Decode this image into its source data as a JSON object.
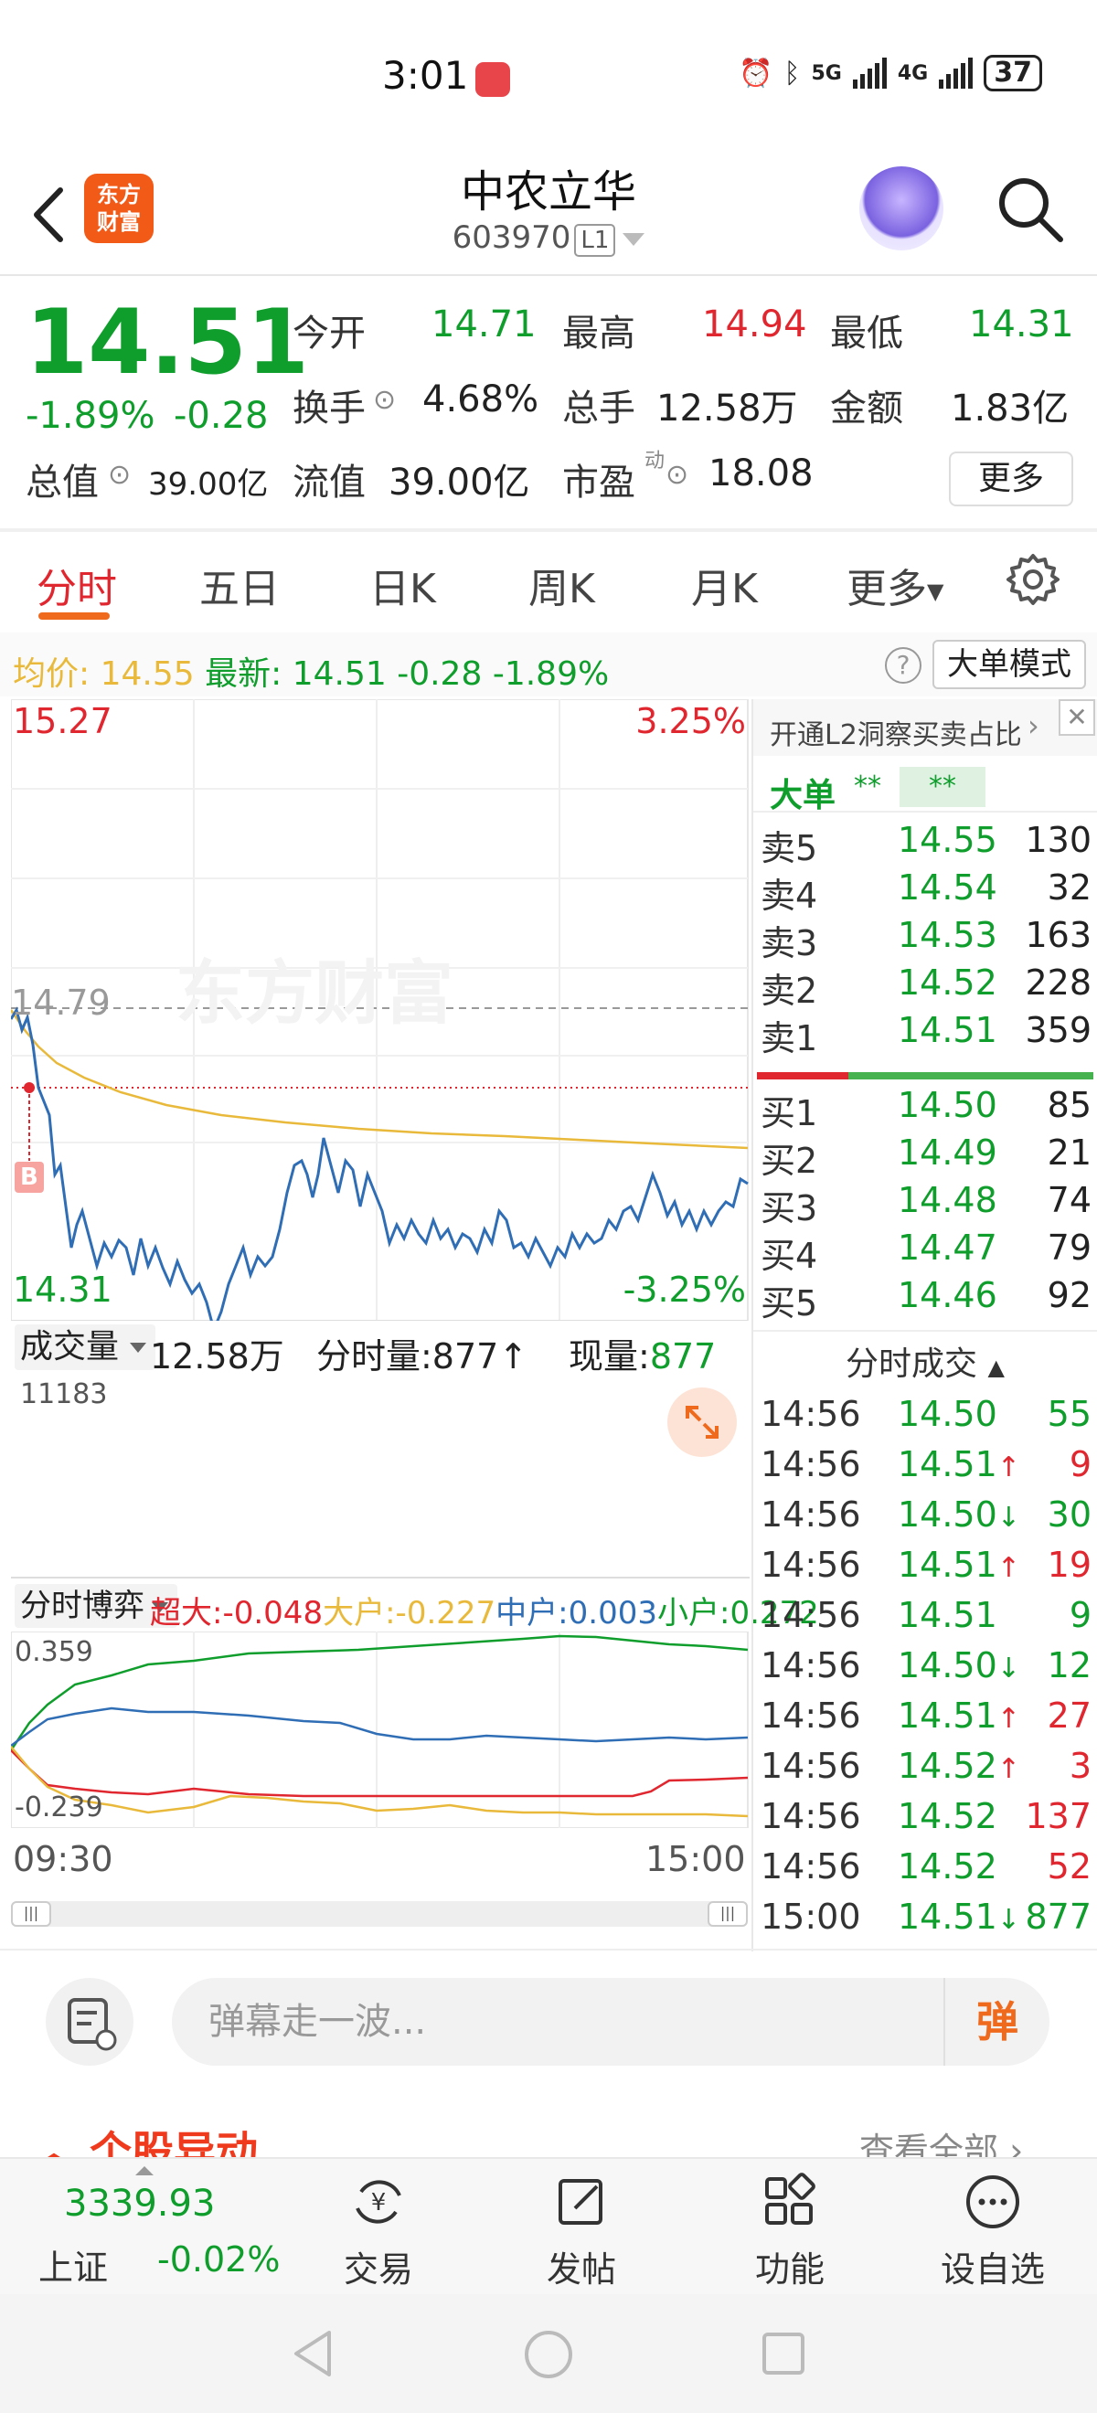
{
  "status_bar": {
    "time": "3:01",
    "network_5g": "5G",
    "network_4g": "4G",
    "battery": "37"
  },
  "header": {
    "title": "中农立华",
    "code": "603970",
    "level": "L1",
    "logo_text_1": "东方",
    "logo_text_2": "财富"
  },
  "quote": {
    "price": "14.51",
    "change_pct": "-1.89%",
    "change_val": "-0.28",
    "open_label": "今开",
    "open": "14.71",
    "high_label": "最高",
    "high": "14.94",
    "low_label": "最低",
    "low": "14.31",
    "turnover_label": "换手",
    "turnover": "4.68%",
    "volume_label": "总手",
    "volume": "12.58万",
    "amount_label": "金额",
    "amount": "1.83亿",
    "total_value_label": "总值",
    "total_value": "39.00亿",
    "float_value_label": "流值",
    "float_value": "39.00亿",
    "pe_label": "市盈",
    "pe_sup": "动",
    "pe": "18.08",
    "more": "更多"
  },
  "tabs": [
    "分时",
    "五日",
    "日K",
    "周K",
    "月K",
    "更多"
  ],
  "avg_bar": {
    "avg_label": "均价:",
    "avg": "14.55",
    "latest_label": "最新:",
    "latest": "14.51",
    "chg": "-0.28",
    "pct": "-1.89%",
    "help": "?",
    "big_order_mode": "大单模式"
  },
  "chart": {
    "high_price": "15.27",
    "high_pct": "3.25%",
    "low_price": "14.31",
    "low_pct": "-3.25%",
    "prev_close": "14.79",
    "watermark": "东方财富",
    "buy_marker": "B"
  },
  "volume": {
    "label": "成交量",
    "total": "12.58万",
    "tick_vol": "分时量:877",
    "now_label": "现量:",
    "now": "877",
    "max": "11183"
  },
  "flow": {
    "label": "分时博弈",
    "super_label": "超大:",
    "super": "-0.048",
    "big_label": "大户:",
    "big": "-0.227",
    "mid_label": "中户:",
    "mid": "0.003",
    "small_label": "小户:",
    "small": "0.272",
    "top": "0.359",
    "bottom": "-0.239"
  },
  "time_axis": {
    "start": "09:30",
    "end": "15:00"
  },
  "l2_banner": "开通L2洞察买卖占比",
  "big_order": {
    "label": "大单",
    "v1": "**",
    "v2": "**"
  },
  "sells": [
    {
      "label": "卖5",
      "price": "14.55",
      "qty": "130"
    },
    {
      "label": "卖4",
      "price": "14.54",
      "qty": "32"
    },
    {
      "label": "卖3",
      "price": "14.53",
      "qty": "163"
    },
    {
      "label": "卖2",
      "price": "14.52",
      "qty": "228"
    },
    {
      "label": "卖1",
      "price": "14.51",
      "qty": "359"
    }
  ],
  "buys": [
    {
      "label": "买1",
      "price": "14.50",
      "qty": "85"
    },
    {
      "label": "买2",
      "price": "14.49",
      "qty": "21"
    },
    {
      "label": "买3",
      "price": "14.48",
      "qty": "74"
    },
    {
      "label": "买4",
      "price": "14.47",
      "qty": "79"
    },
    {
      "label": "买5",
      "price": "14.46",
      "qty": "92"
    }
  ],
  "trades_title": "分时成交",
  "trades": [
    {
      "time": "14:56",
      "price": "14.50",
      "arrow": "",
      "qty": "55",
      "qcolor": "#0f9d2c"
    },
    {
      "time": "14:56",
      "price": "14.51",
      "arrow": "↑",
      "qty": "9",
      "qcolor": "#e0262f"
    },
    {
      "time": "14:56",
      "price": "14.50",
      "arrow": "↓",
      "qty": "30",
      "qcolor": "#0f9d2c"
    },
    {
      "time": "14:56",
      "price": "14.51",
      "arrow": "↑",
      "qty": "19",
      "qcolor": "#e0262f"
    },
    {
      "time": "14:56",
      "price": "14.51",
      "arrow": "",
      "qty": "9",
      "qcolor": "#0f9d2c"
    },
    {
      "time": "14:56",
      "price": "14.50",
      "arrow": "↓",
      "qty": "12",
      "qcolor": "#0f9d2c"
    },
    {
      "time": "14:56",
      "price": "14.51",
      "arrow": "↑",
      "qty": "27",
      "qcolor": "#e0262f"
    },
    {
      "time": "14:56",
      "price": "14.52",
      "arrow": "↑",
      "qty": "3",
      "qcolor": "#e0262f"
    },
    {
      "time": "14:56",
      "price": "14.52",
      "arrow": "",
      "qty": "137",
      "qcolor": "#e0262f"
    },
    {
      "time": "14:56",
      "price": "14.52",
      "arrow": "",
      "qty": "52",
      "qcolor": "#e0262f"
    },
    {
      "time": "15:00",
      "price": "14.51",
      "arrow": "↓",
      "qty": "877",
      "qcolor": "#0f9d2c"
    }
  ],
  "comment": {
    "placeholder": "弹幕走一波...",
    "danmu": "弹"
  },
  "section": {
    "title": "个股异动",
    "view_all": "查看全部"
  },
  "bottom_nav": {
    "index_value": "3339.93",
    "index_name": "上证",
    "index_chg": "-0.02%",
    "trade": "交易",
    "post": "发帖",
    "func": "功能",
    "watch": "设自选"
  },
  "colors": {
    "up": "#e0262f",
    "down": "#0f9d2c",
    "accent": "#ef6a1d",
    "avg_line": "#e8b93a",
    "price_line": "#2f6db5"
  }
}
